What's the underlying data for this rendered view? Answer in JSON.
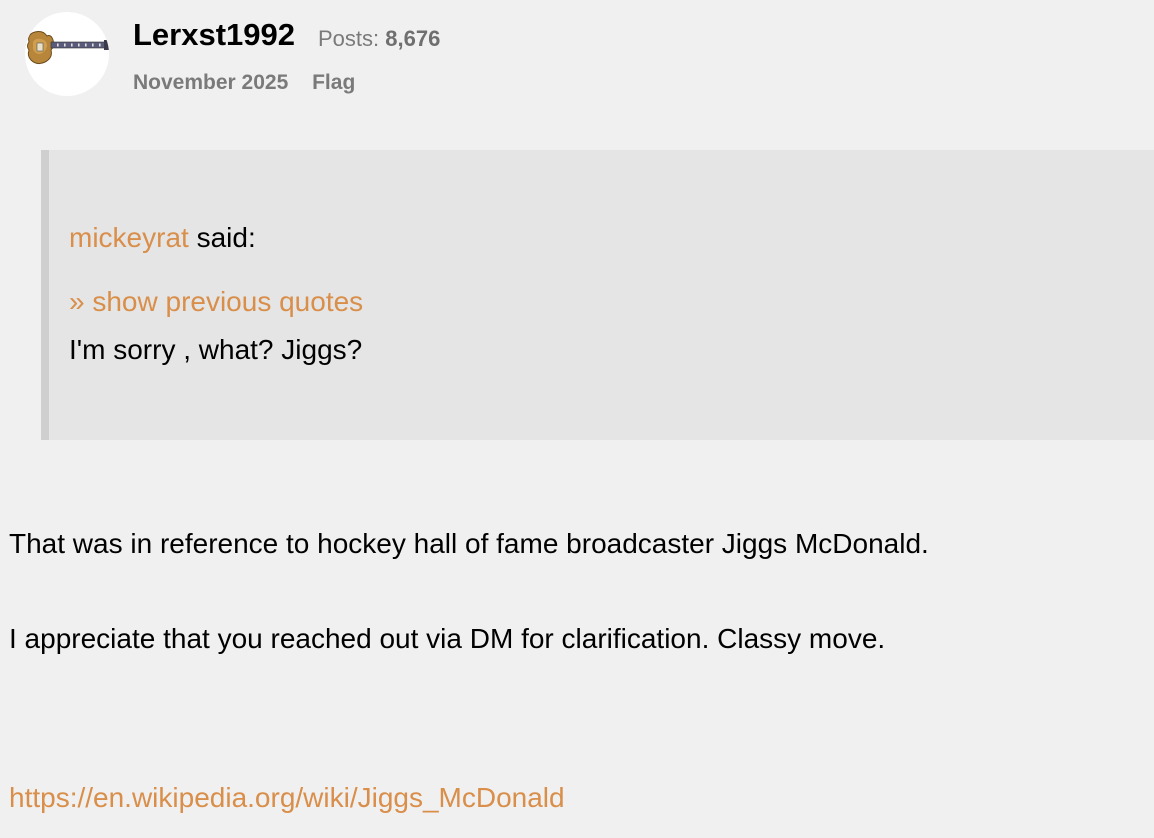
{
  "post": {
    "author": "Lerxst1992",
    "posts_label": "Posts:",
    "posts_count": "8,676",
    "date": "November 2025",
    "flag_label": "Flag"
  },
  "quote": {
    "quoted_user": "mickeyrat",
    "said_label": "said:",
    "show_previous_label": "» show previous quotes",
    "text": "I'm sorry , what? Jiggs?"
  },
  "body": {
    "paragraphs": [
      "That was in reference to hockey hall of fame broadcaster Jiggs McDonald.",
      "I appreciate that you reached out via DM for clarification. Classy move."
    ],
    "link": "https://en.wikipedia.org/wiki/Jiggs_McDonald"
  },
  "colors": {
    "link": "#d98e4a",
    "quote_background": "#e5e5e5",
    "page_background": "#f0f0f0"
  },
  "icons": {
    "avatar": "guitar-avatar-icon"
  }
}
